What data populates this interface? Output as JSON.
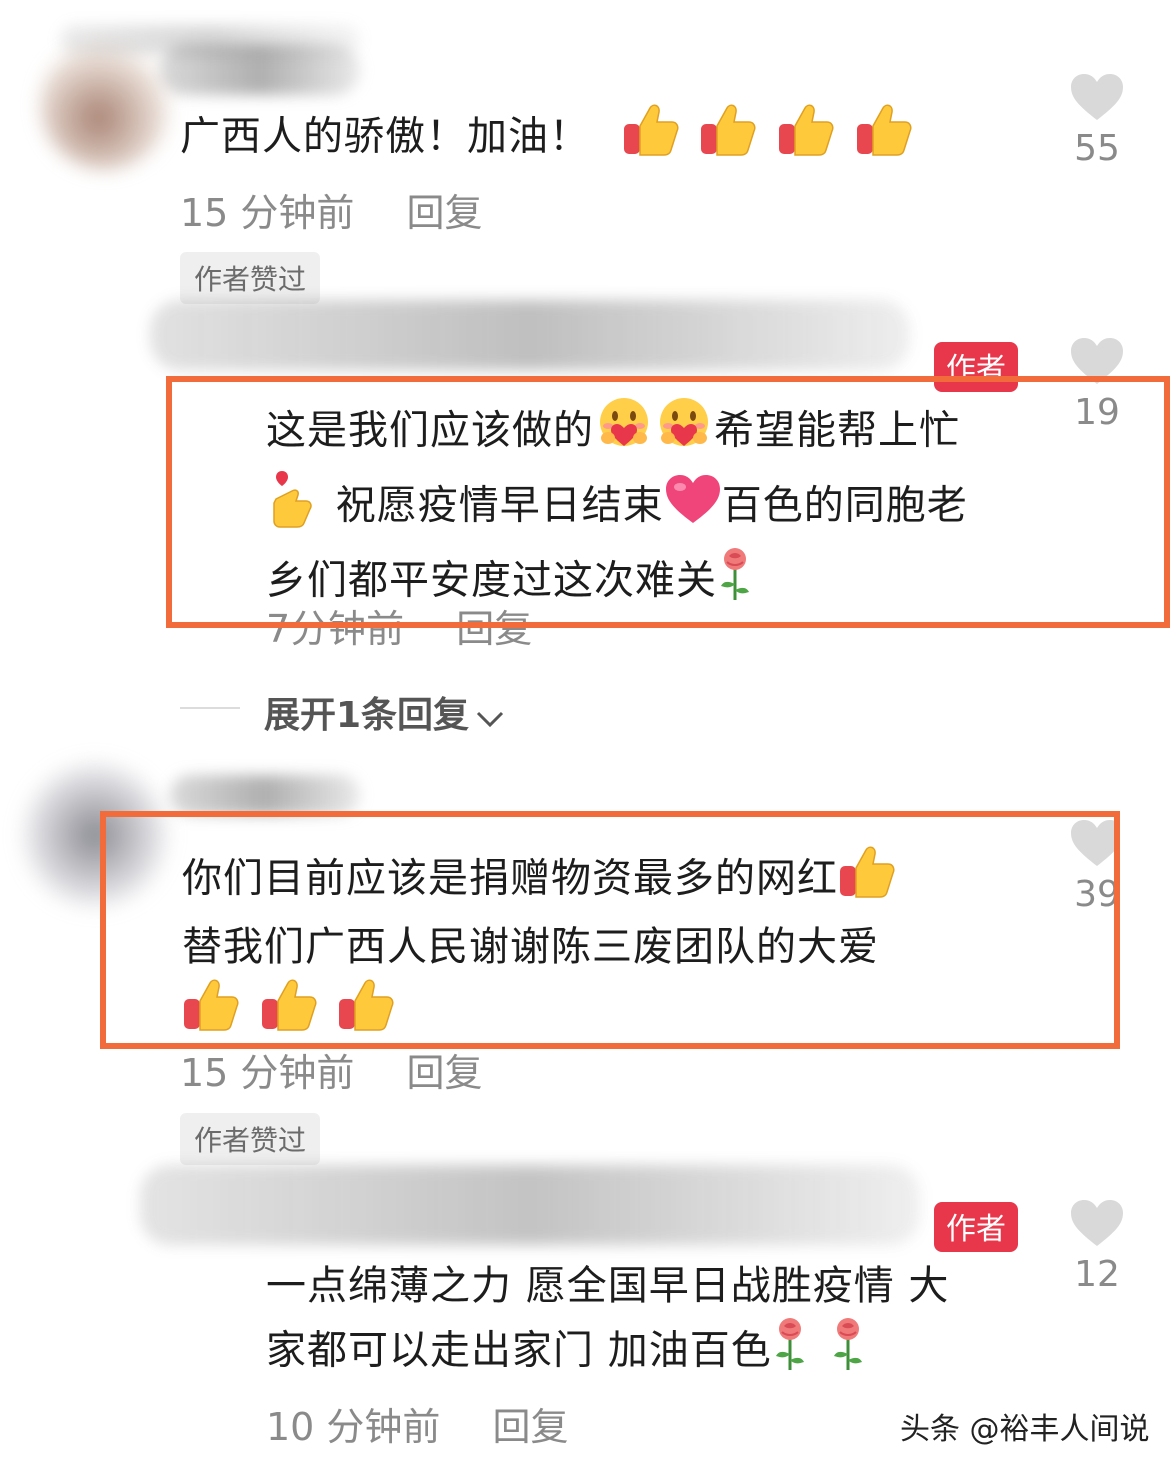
{
  "comments": [
    {
      "text": "广西人的骄傲！加油！",
      "emoji_tail": [
        "thumbs-up",
        "thumbs-up",
        "thumbs-up",
        "thumbs-up"
      ],
      "time": "15 分钟前",
      "reply_label": "回复",
      "liked_badge": "作者赞过",
      "likes": "55"
    },
    {
      "author_badge": "作者",
      "line1": "这是我们应该做的",
      "line1b": "希望能帮上忙",
      "line2": "祝愿疫情早日结束",
      "line2b": "百色的同胞老",
      "line3": "乡们都平安度过这次难关",
      "time": "7分钟前",
      "reply_label": "回复",
      "likes": "19",
      "expand_label": "展开1条回复"
    },
    {
      "line1": "你们目前应该是捐赠物资最多的网红",
      "line2": "替我们广西人民谢谢陈三废团队的大爱",
      "time": "15 分钟前",
      "reply_label": "回复",
      "liked_badge": "作者赞过",
      "likes": "39"
    },
    {
      "author_badge": "作者",
      "line1": "一点绵薄之力 愿全国早日战胜疫情 大",
      "line2": "家都可以走出家门 加油百色",
      "time": "10 分钟前",
      "reply_label": "回复",
      "likes": "12"
    }
  ],
  "watermark": "头条 @裕丰人间说",
  "colors": {
    "highlight_box": "#f26b3a",
    "author_badge": "#e8374a",
    "meta_text": "#8a8a8a",
    "heart": "#d9d9d9"
  }
}
